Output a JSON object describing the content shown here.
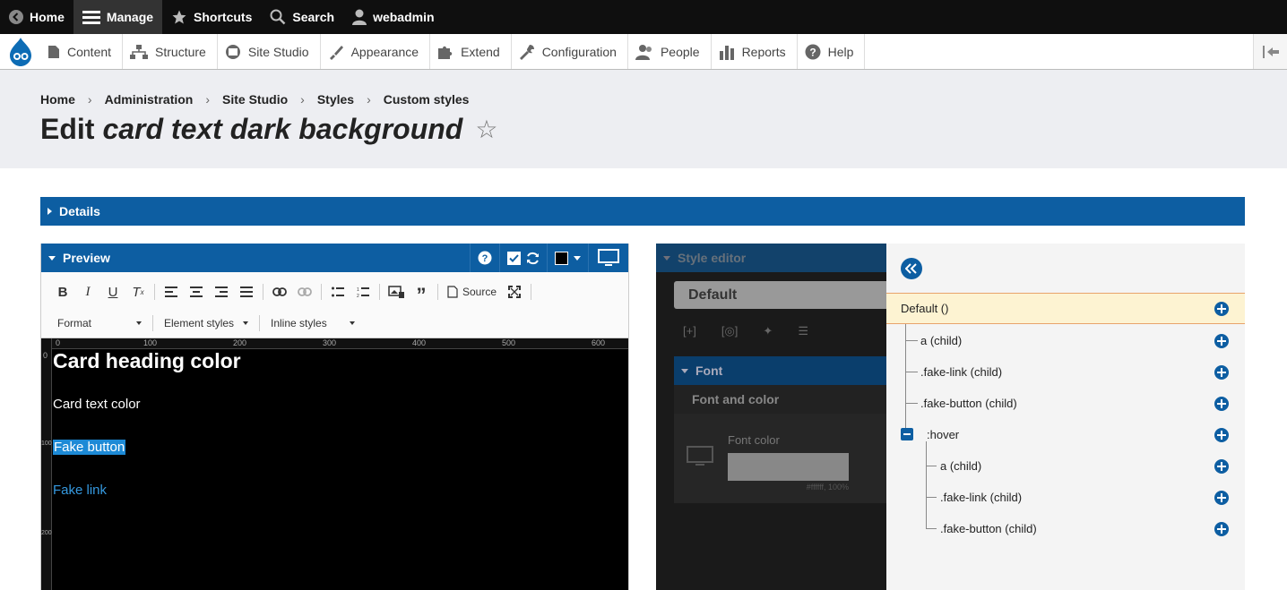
{
  "toolbar": {
    "home": "Home",
    "manage": "Manage",
    "shortcuts": "Shortcuts",
    "search": "Search",
    "user": "webadmin"
  },
  "admin_menu": [
    {
      "label": "Content",
      "icon": "file-icon"
    },
    {
      "label": "Structure",
      "icon": "sitemap-icon"
    },
    {
      "label": "Site Studio",
      "icon": "site-studio-icon"
    },
    {
      "label": "Appearance",
      "icon": "brush-icon"
    },
    {
      "label": "Extend",
      "icon": "puzzle-icon"
    },
    {
      "label": "Configuration",
      "icon": "wrench-icon"
    },
    {
      "label": "People",
      "icon": "people-icon"
    },
    {
      "label": "Reports",
      "icon": "bar-chart-icon"
    },
    {
      "label": "Help",
      "icon": "help-icon"
    }
  ],
  "breadcrumb": [
    "Home",
    "Administration",
    "Site Studio",
    "Styles",
    "Custom styles"
  ],
  "page": {
    "title_prefix": "Edit",
    "title_name": "card text dark background",
    "star": "☆"
  },
  "details": {
    "label": "Details"
  },
  "preview": {
    "label": "Preview",
    "help": "?",
    "source_label": "Source",
    "format_label": "Format",
    "element_styles_label": "Element styles",
    "inline_styles_label": "Inline styles",
    "ruler_top": [
      "0",
      "100",
      "200",
      "300",
      "400",
      "500",
      "600"
    ],
    "ruler_left": [
      "0",
      "100",
      "200"
    ],
    "card_heading": "Card heading color",
    "card_text": "Card text color",
    "fake_button": "Fake button",
    "fake_link": "Fake link"
  },
  "style_editor": {
    "label": "Style editor",
    "default_label": "Default",
    "font_label": "Font",
    "font_and_color": "Font and color",
    "font_color_label": "Font color",
    "font_color_value": "#ffffff, 100%"
  },
  "tree": {
    "items": [
      {
        "label": "Default ()",
        "level": 0,
        "selected": true
      },
      {
        "label": "a (child)",
        "level": 1
      },
      {
        "label": ".fake-link (child)",
        "level": 1
      },
      {
        "label": ".fake-button (child)",
        "level": 1
      },
      {
        "label": ":hover",
        "level": 1,
        "expanded": true
      },
      {
        "label": "a (child)",
        "level": 2
      },
      {
        "label": ".fake-link (child)",
        "level": 2
      },
      {
        "label": ".fake-button (child)",
        "level": 2
      }
    ]
  },
  "colors": {
    "accent": "#0d5ea2",
    "toolbar_bg": "#0f0f0f",
    "header_bg": "#edeef2",
    "selection": "#1d8ad6",
    "link": "#3599e0"
  }
}
